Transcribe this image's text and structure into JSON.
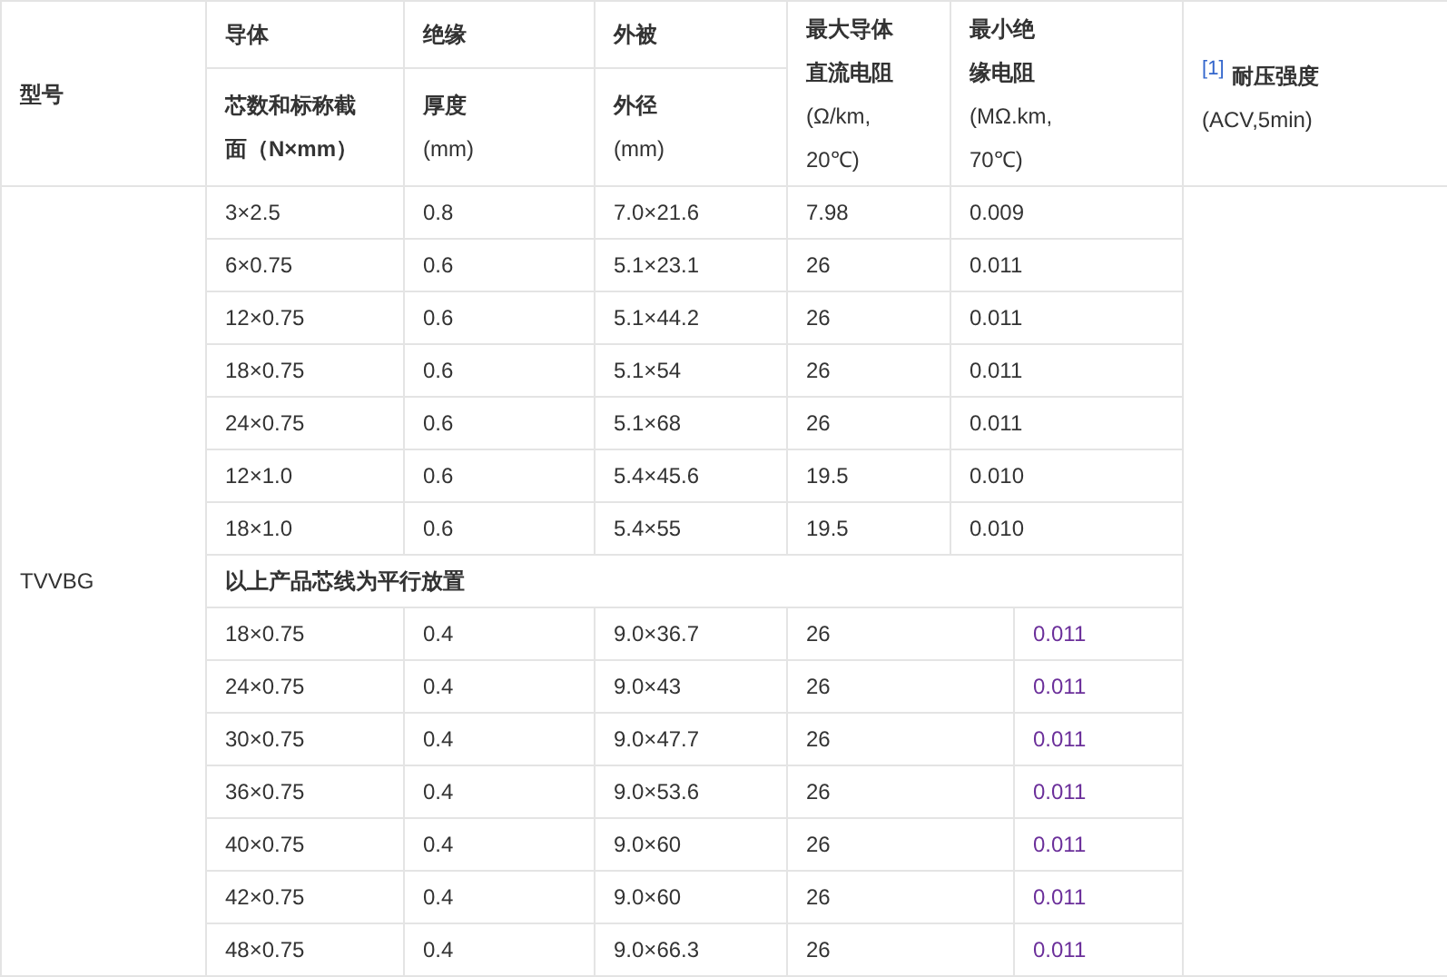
{
  "header": {
    "model": "型号",
    "conductor": "导体",
    "insulation": "绝缘",
    "sheath": "外被",
    "resistance": {
      "title": [
        "最大导体",
        "直流电阻"
      ],
      "unit": [
        "(Ω/km,",
        "20℃)"
      ]
    },
    "insulation_resistance": {
      "title": [
        "最小绝",
        "缘电阻"
      ],
      "unit": [
        "(MΩ.km,",
        "70℃)"
      ]
    },
    "withstand": {
      "ref": "[1]",
      "title": "耐压强度",
      "unit": "(ACV,5min)"
    },
    "cores": {
      "title": [
        "芯数和标称截",
        "面（N×mm）"
      ]
    },
    "thickness": {
      "title": [
        "厚度"
      ],
      "unit": [
        "(mm)"
      ]
    },
    "diameter": {
      "title": [
        "外径"
      ],
      "unit": [
        "(mm)"
      ]
    }
  },
  "model": "TVVBG",
  "sections": [
    {
      "kind": "round",
      "rows": [
        [
          "3×2.5",
          "0.8",
          "7.0×21.6",
          "7.98",
          "0.009"
        ],
        [
          "6×0.75",
          "0.6",
          "5.1×23.1",
          "26",
          "0.011"
        ],
        [
          "12×0.75",
          "0.6",
          "5.1×44.2",
          "26",
          "0.011"
        ],
        [
          "18×0.75",
          "0.6",
          "5.1×54",
          "26",
          "0.011"
        ],
        [
          "24×0.75",
          "0.6",
          "5.1×68",
          "26",
          "0.011"
        ],
        [
          "12×1.0",
          "0.6",
          "5.4×45.6",
          "19.5",
          "0.010"
        ],
        [
          "18×1.0",
          "0.6",
          "5.4×55",
          "19.5",
          "0.010"
        ]
      ]
    },
    {
      "kind": "note",
      "text": "以上产品芯线为平行放置"
    },
    {
      "kind": "flat",
      "rows": [
        [
          "18×0.75",
          "0.4",
          "9.0×36.7",
          "26",
          "0.011"
        ],
        [
          "24×0.75",
          "0.4",
          "9.0×43",
          "26",
          "0.011"
        ],
        [
          "30×0.75",
          "0.4",
          "9.0×47.7",
          "26",
          "0.011"
        ],
        [
          "36×0.75",
          "0.4",
          "9.0×53.6",
          "26",
          "0.011"
        ],
        [
          "40×0.75",
          "0.4",
          "9.0×60",
          "26",
          "0.011"
        ],
        [
          "42×0.75",
          "0.4",
          "9.0×60",
          "26",
          "0.011"
        ],
        [
          "48×0.75",
          "0.4",
          "9.0×66.3",
          "26",
          "0.011"
        ]
      ]
    }
  ]
}
